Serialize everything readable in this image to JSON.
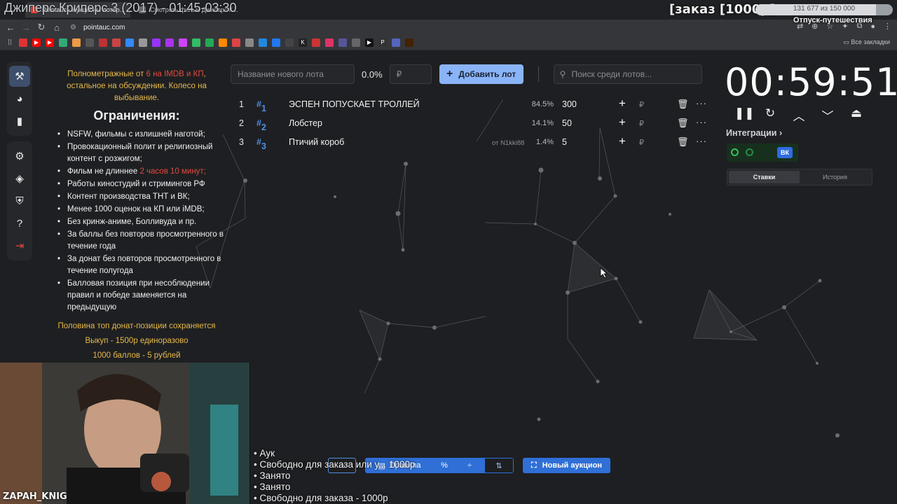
{
  "stream": {
    "title": "Джиперс Криперс 3 (2017) - 01:45-03:30",
    "order_banner": "[заказ [1000р]",
    "progress_text": "131 677 из 150 000",
    "progress_fraction": 0.878,
    "vacation": "Отпуск-путешествия",
    "webcam_name": "ZAPAH_KNIG"
  },
  "browser": {
    "tabs": [
      "Pointauc - Аукционы лотер...",
      "Смотреть фильм Джиперс К..."
    ],
    "url": "pointauc.com",
    "all_bookmarks": "Все закладки"
  },
  "rules": {
    "top_note_1": "Полнометражные от ",
    "top_note_red": "6 на IMDB и КП",
    "top_note_2": ", остальное на обсуждении. Колесо на выбывание.",
    "heading": "Ограничения:",
    "items": [
      "NSFW, фильмы с излишней наготой;",
      "Провокационный полит и религиозный контент с розжигом;",
      "Фильм не длиннее ",
      "Работы киностудий и стримингов РФ",
      "Контент производства ТНТ и ВК;",
      "Менее 1000 оценок на КП или iMDB;",
      "Без кринж-аниме, Болливуда и пр.",
      "За баллы без повторов просмотренного в течение года",
      "За донат без повторов просмотренного в течение полугода",
      "Балловая позиция при несоблюдении правил и победе заменяется на предыдущую"
    ],
    "item3_red": "2 часов 10 минут;",
    "footer": [
      "Половина топ донат-позиции сохраняется",
      "Выкуп - 1500р единоразово",
      "1000 баллов - 5 рублей"
    ]
  },
  "lot_bar": {
    "name_placeholder": "Название нового лота",
    "percent": "0.0%",
    "amount_placeholder": "₽",
    "add_label": "Добавить лот",
    "search_placeholder": "Поиск среди лотов..."
  },
  "lots": [
    {
      "num": "1",
      "id": "1",
      "name": "ЭСПЕН ПОПУСКАЕТ ТРОЛЛЕЙ",
      "from": "",
      "pct": "84.5%",
      "value": "300"
    },
    {
      "num": "2",
      "id": "2",
      "name": "Лобстер",
      "from": "",
      "pct": "14.1%",
      "value": "50"
    },
    {
      "num": "3",
      "id": "3",
      "name": "Птичий короб",
      "from": "от N1kki88",
      "pct": "1.4%",
      "value": "5"
    }
  ],
  "currency": "₽",
  "timer": {
    "value": "00:59:51"
  },
  "integrations": {
    "label": "Интеграции",
    "vk": "ВК"
  },
  "right_tabs": [
    "Ставки",
    "История"
  ],
  "bottom": {
    "rules_label": "Правила",
    "new_auction": "Новый аукцион"
  },
  "overlay_list": [
    "• Аук",
    "• Свободно для заказа или у... 1000р",
    "• Занято",
    "• Занято",
    "• Свободно для заказа - 1000р"
  ],
  "colors": {
    "accent": "#8ab4f8",
    "primary_blue": "#2f6fd6",
    "gold": "#e7b94a",
    "red": "#e14b3d",
    "bg": "#1e1f22"
  }
}
